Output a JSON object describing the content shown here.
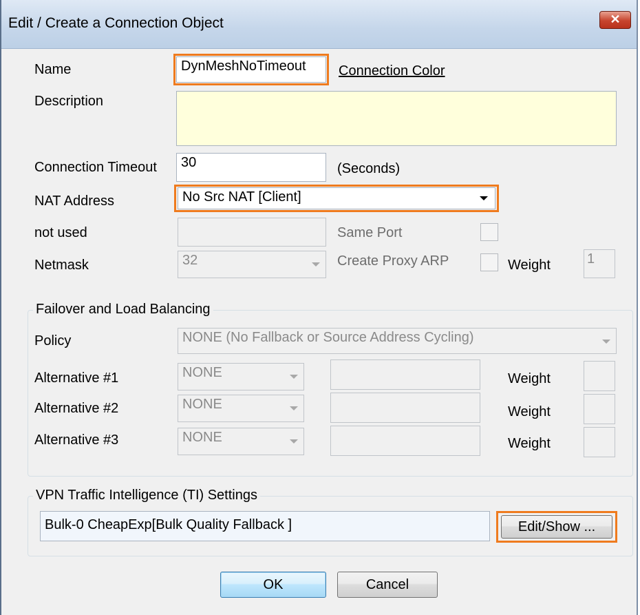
{
  "window": {
    "title": "Edit / Create a Connection Object",
    "close_glyph": "✕"
  },
  "name": {
    "label": "Name",
    "value": "DynMeshNoTimeout",
    "color_link": "Connection Color"
  },
  "description": {
    "label": "Description",
    "value": ""
  },
  "timeout": {
    "label": "Connection Timeout",
    "value": "30",
    "unit": "(Seconds)"
  },
  "nat": {
    "label": "NAT Address",
    "value": "No Src NAT [Client]"
  },
  "not_used": {
    "label": "not used",
    "value": ""
  },
  "same_port": {
    "label": "Same Port",
    "checked": false
  },
  "netmask": {
    "label": "Netmask",
    "value": "32"
  },
  "proxy_arp": {
    "label": "Create Proxy ARP",
    "checked": false
  },
  "weight_top": {
    "label": "Weight",
    "value": "1"
  },
  "failover": {
    "title": "Failover and Load Balancing",
    "policy_label": "Policy",
    "policy_value": "NONE (No Fallback or Source Address Cycling)",
    "alternatives": [
      {
        "label": "Alternative #1",
        "value": "NONE",
        "field": "",
        "weight_label": "Weight",
        "weight": ""
      },
      {
        "label": "Alternative #2",
        "value": "NONE",
        "field": "",
        "weight_label": "Weight",
        "weight": ""
      },
      {
        "label": "Alternative #3",
        "value": "NONE",
        "field": "",
        "weight_label": "Weight",
        "weight": ""
      }
    ]
  },
  "ti": {
    "title": "VPN Traffic Intelligence (TI) Settings",
    "value": "Bulk-0 CheapExp[Bulk Quality Fallback ]",
    "edit_button": "Edit/Show ..."
  },
  "buttons": {
    "ok": "OK",
    "cancel": "Cancel"
  },
  "colors": {
    "highlight": "#ef7b1e",
    "description_bg": "#ffffdc",
    "title_gradient": "#c5d6ea"
  }
}
